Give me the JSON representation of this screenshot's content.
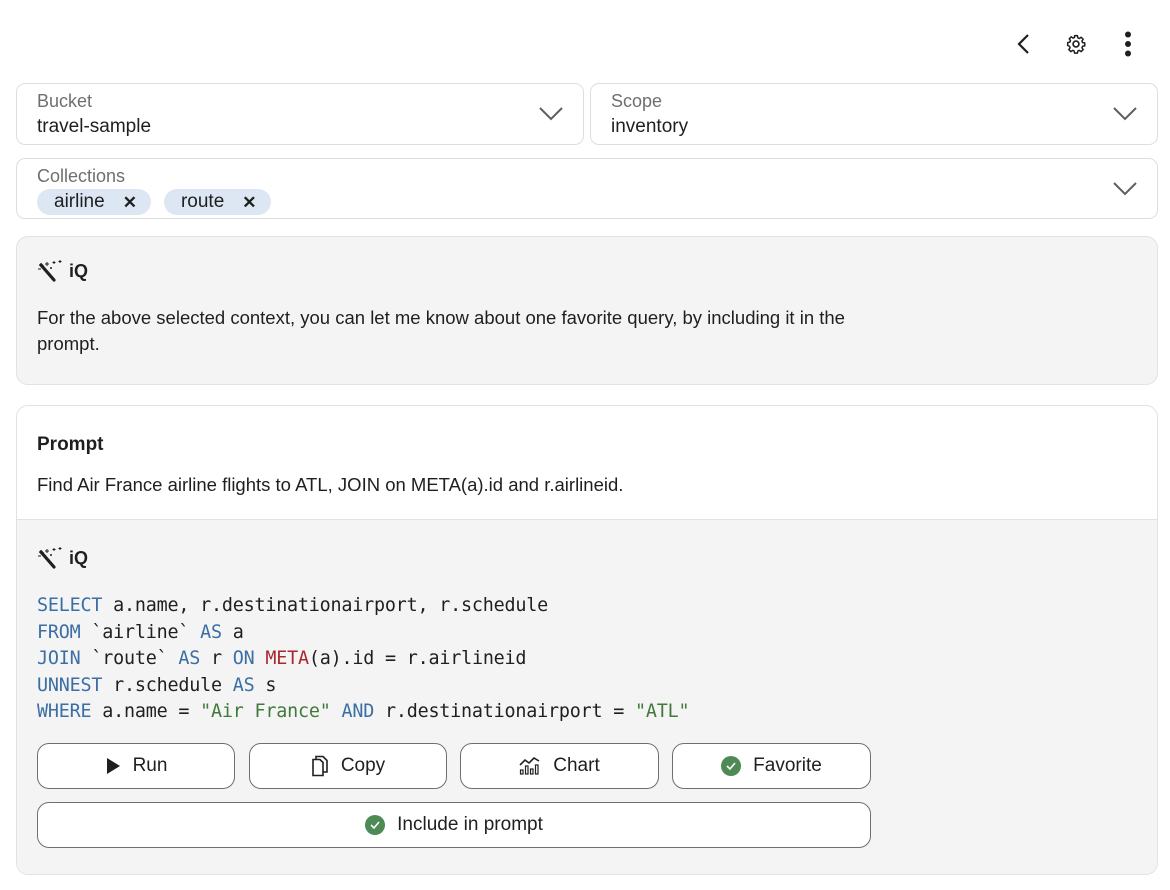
{
  "toolbar": {
    "back_icon": "chevron-left-icon",
    "settings_icon": "gear-icon",
    "more_icon": "more-vertical-icon"
  },
  "bucket": {
    "label": "Bucket",
    "value": "travel-sample"
  },
  "scope": {
    "label": "Scope",
    "value": "inventory"
  },
  "collections": {
    "label": "Collections",
    "chips": [
      {
        "label": "airline",
        "remove": "✕"
      },
      {
        "label": "route",
        "remove": "✕"
      }
    ]
  },
  "iq_intro": {
    "title": "iQ",
    "icon": "magic-wand-icon",
    "message": "For the above selected context, you can let me know about one favorite query, by including it in the prompt."
  },
  "prompt": {
    "title": "Prompt",
    "text": "Find Air France airline flights to ATL, JOIN on META(a).id and r.airlineid."
  },
  "answer": {
    "title": "iQ",
    "code_lines": [
      [
        {
          "t": "SELECT",
          "c": "kw"
        },
        {
          "t": " a.name, r.destinationairport, r.schedule",
          "c": ""
        }
      ],
      [
        {
          "t": "FROM",
          "c": "kw"
        },
        {
          "t": " `airline` ",
          "c": ""
        },
        {
          "t": "AS",
          "c": "kw"
        },
        {
          "t": " a",
          "c": ""
        }
      ],
      [
        {
          "t": "JOIN",
          "c": "kw"
        },
        {
          "t": " `route` ",
          "c": ""
        },
        {
          "t": "AS",
          "c": "kw"
        },
        {
          "t": " r ",
          "c": ""
        },
        {
          "t": "ON",
          "c": "kw"
        },
        {
          "t": " ",
          "c": ""
        },
        {
          "t": "META",
          "c": "fn"
        },
        {
          "t": "(a).id = r.airlineid",
          "c": ""
        }
      ],
      [
        {
          "t": "UNNEST",
          "c": "kw"
        },
        {
          "t": " r.schedule ",
          "c": ""
        },
        {
          "t": "AS",
          "c": "kw"
        },
        {
          "t": " s",
          "c": ""
        }
      ],
      [
        {
          "t": "WHERE",
          "c": "kw"
        },
        {
          "t": " a.name = ",
          "c": ""
        },
        {
          "t": "\"Air France\"",
          "c": "str"
        },
        {
          "t": " ",
          "c": ""
        },
        {
          "t": "AND",
          "c": "kw"
        },
        {
          "t": " r.destinationairport = ",
          "c": ""
        },
        {
          "t": "\"ATL\"",
          "c": "str"
        }
      ]
    ],
    "buttons": {
      "run": "Run",
      "copy": "Copy",
      "chart": "Chart",
      "favorite": "Favorite",
      "include": "Include in prompt"
    }
  },
  "colors": {
    "keyword": "#3a6ea5",
    "function": "#a8292d",
    "string": "#3f7a3a",
    "check_green": "#4e8a55",
    "chip_bg": "#dde7f3"
  }
}
